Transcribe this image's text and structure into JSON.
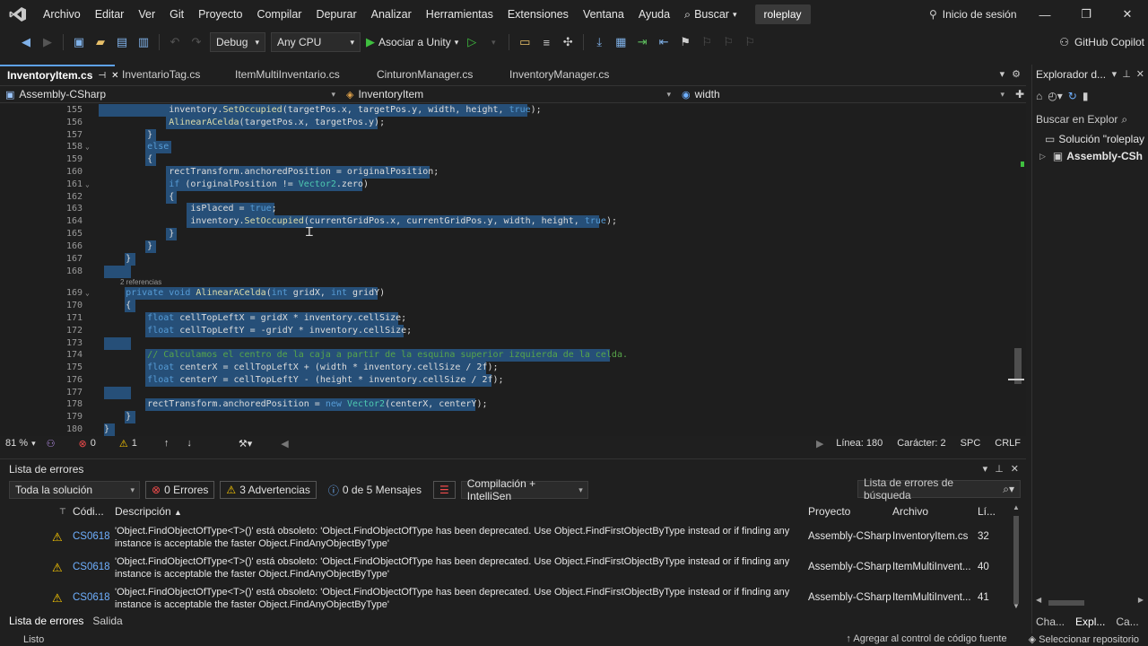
{
  "menu": {
    "logo_icon": "visual-studio-logo",
    "items": [
      "Archivo",
      "Editar",
      "Ver",
      "Git",
      "Proyecto",
      "Compilar",
      "Depurar",
      "Analizar",
      "Herramientas",
      "Extensiones",
      "Ventana",
      "Ayuda"
    ],
    "search_label": "Buscar",
    "solution_name": "roleplay",
    "sign_in_label": "Inicio de sesión"
  },
  "toolbar": {
    "config": "Debug",
    "platform": "Any CPU",
    "run_label": "Asociar a Unity",
    "copilot_label": "GitHub Copilot"
  },
  "editor_tabs": [
    {
      "label": "InventoryItem.cs",
      "active": true
    },
    {
      "label": "InventarioTag.cs",
      "active": false
    },
    {
      "label": "ItemMultiInventario.cs",
      "active": false
    },
    {
      "label": "CinturonManager.cs",
      "active": false
    },
    {
      "label": "InventoryManager.cs",
      "active": false
    }
  ],
  "navbar": {
    "project": "Assembly-CSharp",
    "class": "InventoryItem",
    "member": "width"
  },
  "code": {
    "ref_hint": "2 referencias",
    "lines": [
      {
        "num": "155",
        "text": "            inventory.SetOccupied(targetPos.x, targetPos.y, width, height, true);"
      },
      {
        "num": "156",
        "text": "            AlinearACelda(targetPos.x, targetPos.y);"
      },
      {
        "num": "157",
        "text": "        }"
      },
      {
        "num": "158",
        "text": "        else"
      },
      {
        "num": "159",
        "text": "        {"
      },
      {
        "num": "160",
        "text": "            rectTransform.anchoredPosition = originalPosition;"
      },
      {
        "num": "161",
        "text": "            if (originalPosition != Vector2.zero)"
      },
      {
        "num": "162",
        "text": "            {"
      },
      {
        "num": "163",
        "text": "                isPlaced = true;"
      },
      {
        "num": "164",
        "text": "                inventory.SetOccupied(currentGridPos.x, currentGridPos.y, width, height, true);"
      },
      {
        "num": "165",
        "text": "            }"
      },
      {
        "num": "166",
        "text": "        }"
      },
      {
        "num": "167",
        "text": "    }"
      },
      {
        "num": "168",
        "text": ""
      },
      {
        "num": "169",
        "text": "    private void AlinearACelda(int gridX, int gridY)"
      },
      {
        "num": "170",
        "text": "    {"
      },
      {
        "num": "171",
        "text": "        float cellTopLeftX = gridX * inventory.cellSize;"
      },
      {
        "num": "172",
        "text": "        float cellTopLeftY = -gridY * inventory.cellSize;"
      },
      {
        "num": "173",
        "text": ""
      },
      {
        "num": "174",
        "text": "        // Calculamos el centro de la caja a partir de la esquina superior izquierda de la celda."
      },
      {
        "num": "175",
        "text": "        float centerX = cellTopLeftX + (width * inventory.cellSize / 2f);"
      },
      {
        "num": "176",
        "text": "        float centerY = cellTopLeftY - (height * inventory.cellSize / 2f);"
      },
      {
        "num": "177",
        "text": ""
      },
      {
        "num": "178",
        "text": "        rectTransform.anchoredPosition = new Vector2(centerX, centerY);"
      },
      {
        "num": "179",
        "text": "    }"
      },
      {
        "num": "180",
        "text": "}"
      }
    ]
  },
  "editor_status": {
    "zoom": "81 %",
    "errors": "0",
    "warnings": "1",
    "line": "Línea: 180",
    "char": "Carácter: 2",
    "spc": "SPC",
    "eol": "CRLF"
  },
  "error_list": {
    "title": "Lista de errores",
    "scope": "Toda la solución",
    "errors_btn": "0 Errores",
    "warnings_btn": "3 Advertencias",
    "messages_btn": "0 de 5 Mensajes",
    "build_filter": "Compilación + IntelliSen",
    "search_placeholder": "Lista de errores de búsqueda",
    "headers": {
      "code": "Códi...",
      "desc": "Descripción",
      "project": "Proyecto",
      "file": "Archivo",
      "line": "Lí..."
    },
    "rows": [
      {
        "code": "CS0618",
        "desc": "'Object.FindObjectOfType<T>()' está obsoleto: 'Object.FindObjectOfType has been deprecated. Use Object.FindFirstObjectByType instead or if finding any instance is acceptable the faster Object.FindAnyObjectByType'",
        "project": "Assembly-CSharp",
        "file": "InventoryItem.cs",
        "line": "32"
      },
      {
        "code": "CS0618",
        "desc": "'Object.FindObjectOfType<T>()' está obsoleto: 'Object.FindObjectOfType has been deprecated. Use Object.FindFirstObjectByType instead or if finding any instance is acceptable the faster Object.FindAnyObjectByType'",
        "project": "Assembly-CSharp",
        "file": "ItemMultiInvent...",
        "line": "40"
      },
      {
        "code": "CS0618",
        "desc": "'Object.FindObjectOfType<T>()' está obsoleto: 'Object.FindObjectOfType has been deprecated. Use Object.FindFirstObjectByType instead or if finding any instance is acceptable the faster Object.FindAnyObjectByType'",
        "project": "Assembly-CSharp",
        "file": "ItemMultiInvent...",
        "line": "41"
      }
    ],
    "bottom_tabs": [
      "Lista de errores",
      "Salida"
    ]
  },
  "solution_explorer": {
    "title": "Explorador d...",
    "search_label": "Buscar en Explor",
    "solution_item": "Solución \"roleplay",
    "project_item": "Assembly-CSh",
    "bottom_tabs": [
      "Cha...",
      "Expl...",
      "Ca..."
    ]
  },
  "statusbar": {
    "left": "Listo",
    "right1": "Agregar al control de código fuente",
    "right2": "Seleccionar repositorio"
  },
  "colors": {
    "selection": "#264f78",
    "accent": "#5ea2ef",
    "warning": "#ffcc00",
    "keyword": "#569cd6",
    "type": "#4ec9b0",
    "comment": "#57a64a"
  }
}
